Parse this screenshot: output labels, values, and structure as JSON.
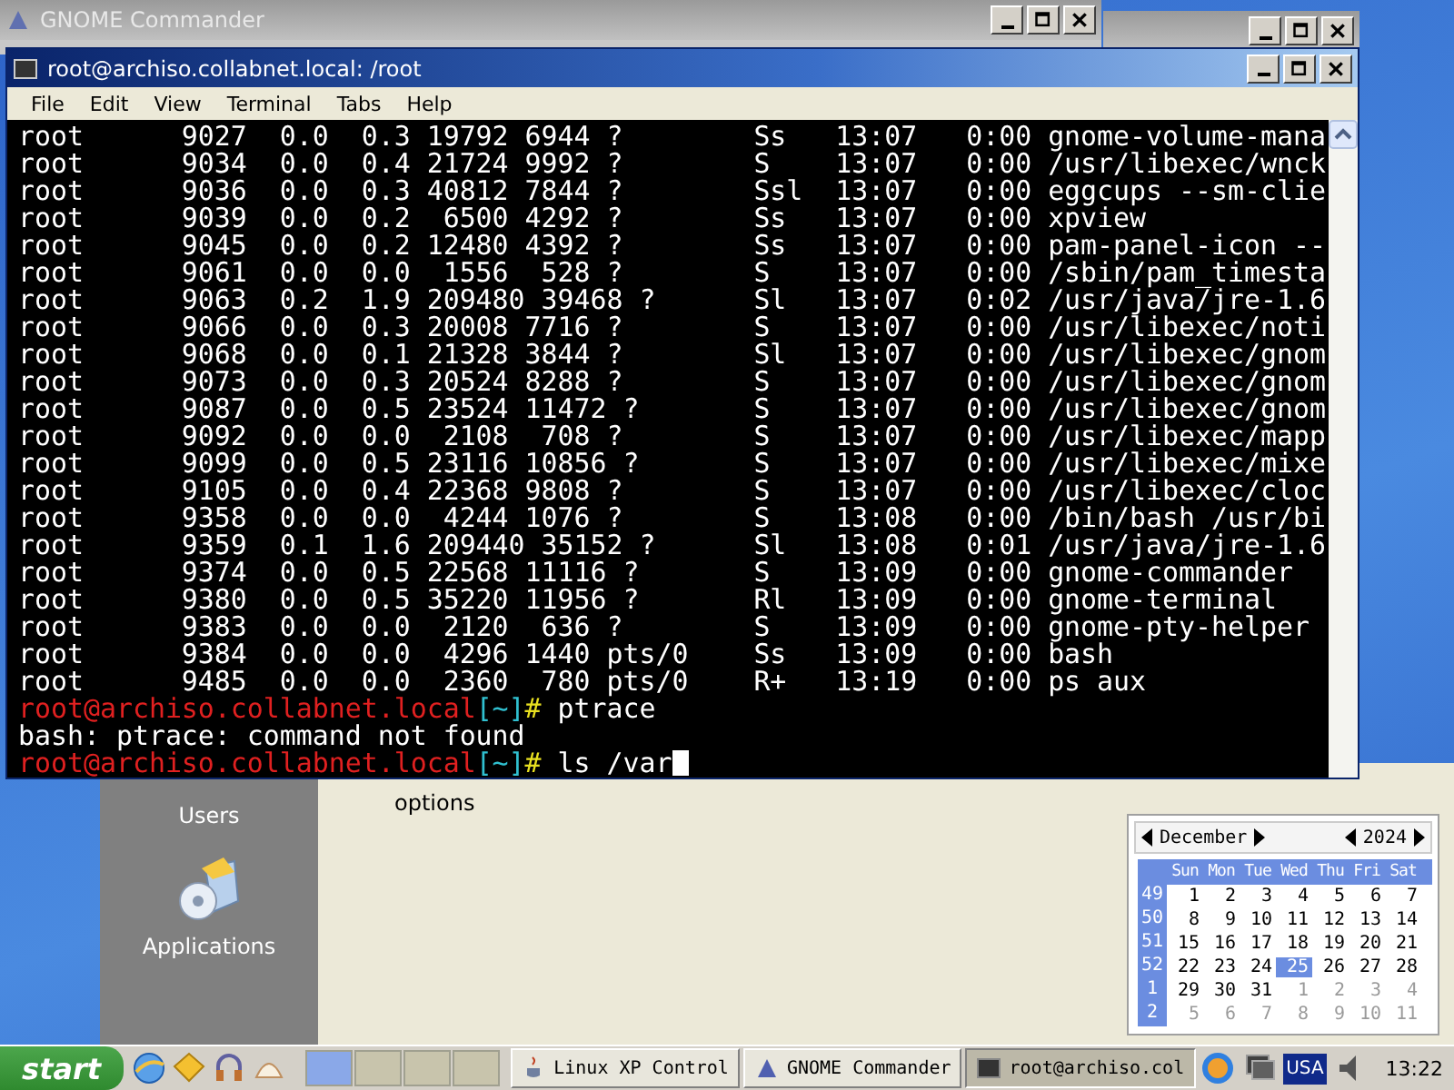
{
  "gnome_commander": {
    "title": "GNOME Commander"
  },
  "terminal": {
    "title": "root@archiso.collabnet.local: /root",
    "menu": [
      "File",
      "Edit",
      "View",
      "Terminal",
      "Tabs",
      "Help"
    ],
    "process_lines": [
      "root      9027  0.0  0.3 19792 6944 ?        Ss   13:07   0:00 gnome-volume-mana",
      "root      9034  0.0  0.4 21724 9992 ?        S    13:07   0:00 /usr/libexec/wnck",
      "root      9036  0.0  0.3 40812 7844 ?        Ssl  13:07   0:00 eggcups --sm-clie",
      "root      9039  0.0  0.2  6500 4292 ?        Ss   13:07   0:00 xpview",
      "root      9045  0.0  0.2 12480 4392 ?        Ss   13:07   0:00 pam-panel-icon --",
      "root      9061  0.0  0.0  1556  528 ?        S    13:07   0:00 /sbin/pam_timesta",
      "root      9063  0.2  1.9 209480 39468 ?      Sl   13:07   0:02 /usr/java/jre-1.6",
      "root      9066  0.0  0.3 20008 7716 ?        S    13:07   0:00 /usr/libexec/noti",
      "root      9068  0.0  0.1 21328 3844 ?        Sl   13:07   0:00 /usr/libexec/gnom",
      "root      9073  0.0  0.3 20524 8288 ?        S    13:07   0:00 /usr/libexec/gnom",
      "root      9087  0.0  0.5 23524 11472 ?       S    13:07   0:00 /usr/libexec/gnom",
      "root      9092  0.0  0.0  2108  708 ?        S    13:07   0:00 /usr/libexec/mapp",
      "root      9099  0.0  0.5 23116 10856 ?       S    13:07   0:00 /usr/libexec/mixe",
      "root      9105  0.0  0.4 22368 9808 ?        S    13:07   0:00 /usr/libexec/cloc",
      "root      9358  0.0  0.0  4244 1076 ?        S    13:08   0:00 /bin/bash /usr/bi",
      "root      9359  0.1  1.6 209440 35152 ?      Sl   13:08   0:01 /usr/java/jre-1.6",
      "root      9374  0.0  0.5 22568 11116 ?       S    13:09   0:00 gnome-commander",
      "root      9380  0.0  0.5 35220 11956 ?       Rl   13:09   0:00 gnome-terminal",
      "root      9383  0.0  0.0  2120  636 ?        S    13:09   0:00 gnome-pty-helper",
      "root      9384  0.0  0.0  4296 1440 pts/0    Ss   13:09   0:00 bash",
      "root      9485  0.0  0.0  2360  780 pts/0    R+   13:19   0:00 ps aux"
    ],
    "session": [
      {
        "kind": "prompt",
        "user_host": "root@archiso.collabnet.local",
        "dir": "[~]",
        "symbol": "#",
        "command": "ptrace",
        "cursor": false
      },
      {
        "kind": "output",
        "text": "bash: ptrace: command not found"
      },
      {
        "kind": "prompt",
        "user_host": "root@archiso.collabnet.local",
        "dir": "[~]",
        "symbol": "#",
        "command": "ls /var",
        "cursor": true
      }
    ]
  },
  "control_panel": {
    "sidebar": [
      {
        "label": "Users"
      },
      {
        "label": "Applications"
      }
    ],
    "items": [
      {
        "label": "options"
      }
    ]
  },
  "calendar": {
    "month": "December",
    "year": "2024",
    "weekdays": [
      "Sun",
      "Mon",
      "Tue",
      "Wed",
      "Thu",
      "Fri",
      "Sat"
    ],
    "weeks": [
      {
        "number": "49",
        "days": [
          {
            "d": "1",
            "in_month": true,
            "selected": false
          },
          {
            "d": "2",
            "in_month": true,
            "selected": false
          },
          {
            "d": "3",
            "in_month": true,
            "selected": false
          },
          {
            "d": "4",
            "in_month": true,
            "selected": false
          },
          {
            "d": "5",
            "in_month": true,
            "selected": false
          },
          {
            "d": "6",
            "in_month": true,
            "selected": false
          },
          {
            "d": "7",
            "in_month": true,
            "selected": false
          }
        ]
      },
      {
        "number": "50",
        "days": [
          {
            "d": "8",
            "in_month": true,
            "selected": false
          },
          {
            "d": "9",
            "in_month": true,
            "selected": false
          },
          {
            "d": "10",
            "in_month": true,
            "selected": false
          },
          {
            "d": "11",
            "in_month": true,
            "selected": false
          },
          {
            "d": "12",
            "in_month": true,
            "selected": false
          },
          {
            "d": "13",
            "in_month": true,
            "selected": false
          },
          {
            "d": "14",
            "in_month": true,
            "selected": false
          }
        ]
      },
      {
        "number": "51",
        "days": [
          {
            "d": "15",
            "in_month": true,
            "selected": false
          },
          {
            "d": "16",
            "in_month": true,
            "selected": false
          },
          {
            "d": "17",
            "in_month": true,
            "selected": false
          },
          {
            "d": "18",
            "in_month": true,
            "selected": false
          },
          {
            "d": "19",
            "in_month": true,
            "selected": false
          },
          {
            "d": "20",
            "in_month": true,
            "selected": false
          },
          {
            "d": "21",
            "in_month": true,
            "selected": false
          }
        ]
      },
      {
        "number": "52",
        "days": [
          {
            "d": "22",
            "in_month": true,
            "selected": false
          },
          {
            "d": "23",
            "in_month": true,
            "selected": false
          },
          {
            "d": "24",
            "in_month": true,
            "selected": false
          },
          {
            "d": "25",
            "in_month": true,
            "selected": true
          },
          {
            "d": "26",
            "in_month": true,
            "selected": false
          },
          {
            "d": "27",
            "in_month": true,
            "selected": false
          },
          {
            "d": "28",
            "in_month": true,
            "selected": false
          }
        ]
      },
      {
        "number": "1",
        "days": [
          {
            "d": "29",
            "in_month": true,
            "selected": false
          },
          {
            "d": "30",
            "in_month": true,
            "selected": false
          },
          {
            "d": "31",
            "in_month": true,
            "selected": false
          },
          {
            "d": "1",
            "in_month": false,
            "selected": false
          },
          {
            "d": "2",
            "in_month": false,
            "selected": false
          },
          {
            "d": "3",
            "in_month": false,
            "selected": false
          },
          {
            "d": "4",
            "in_month": false,
            "selected": false
          }
        ]
      },
      {
        "number": "2",
        "days": [
          {
            "d": "5",
            "in_month": false,
            "selected": false
          },
          {
            "d": "6",
            "in_month": false,
            "selected": false
          },
          {
            "d": "7",
            "in_month": false,
            "selected": false
          },
          {
            "d": "8",
            "in_month": false,
            "selected": false
          },
          {
            "d": "9",
            "in_month": false,
            "selected": false
          },
          {
            "d": "10",
            "in_month": false,
            "selected": false
          },
          {
            "d": "11",
            "in_month": false,
            "selected": false
          }
        ]
      }
    ]
  },
  "taskbar": {
    "start": "start",
    "tasks": [
      {
        "label": "Linux XP Control",
        "kind": "java",
        "selected": false
      },
      {
        "label": "GNOME Commander",
        "kind": "commander",
        "selected": false
      },
      {
        "label": "root@archiso.col",
        "kind": "terminal",
        "selected": true
      }
    ],
    "keyboard_layout": "USA",
    "clock": "13:22"
  }
}
